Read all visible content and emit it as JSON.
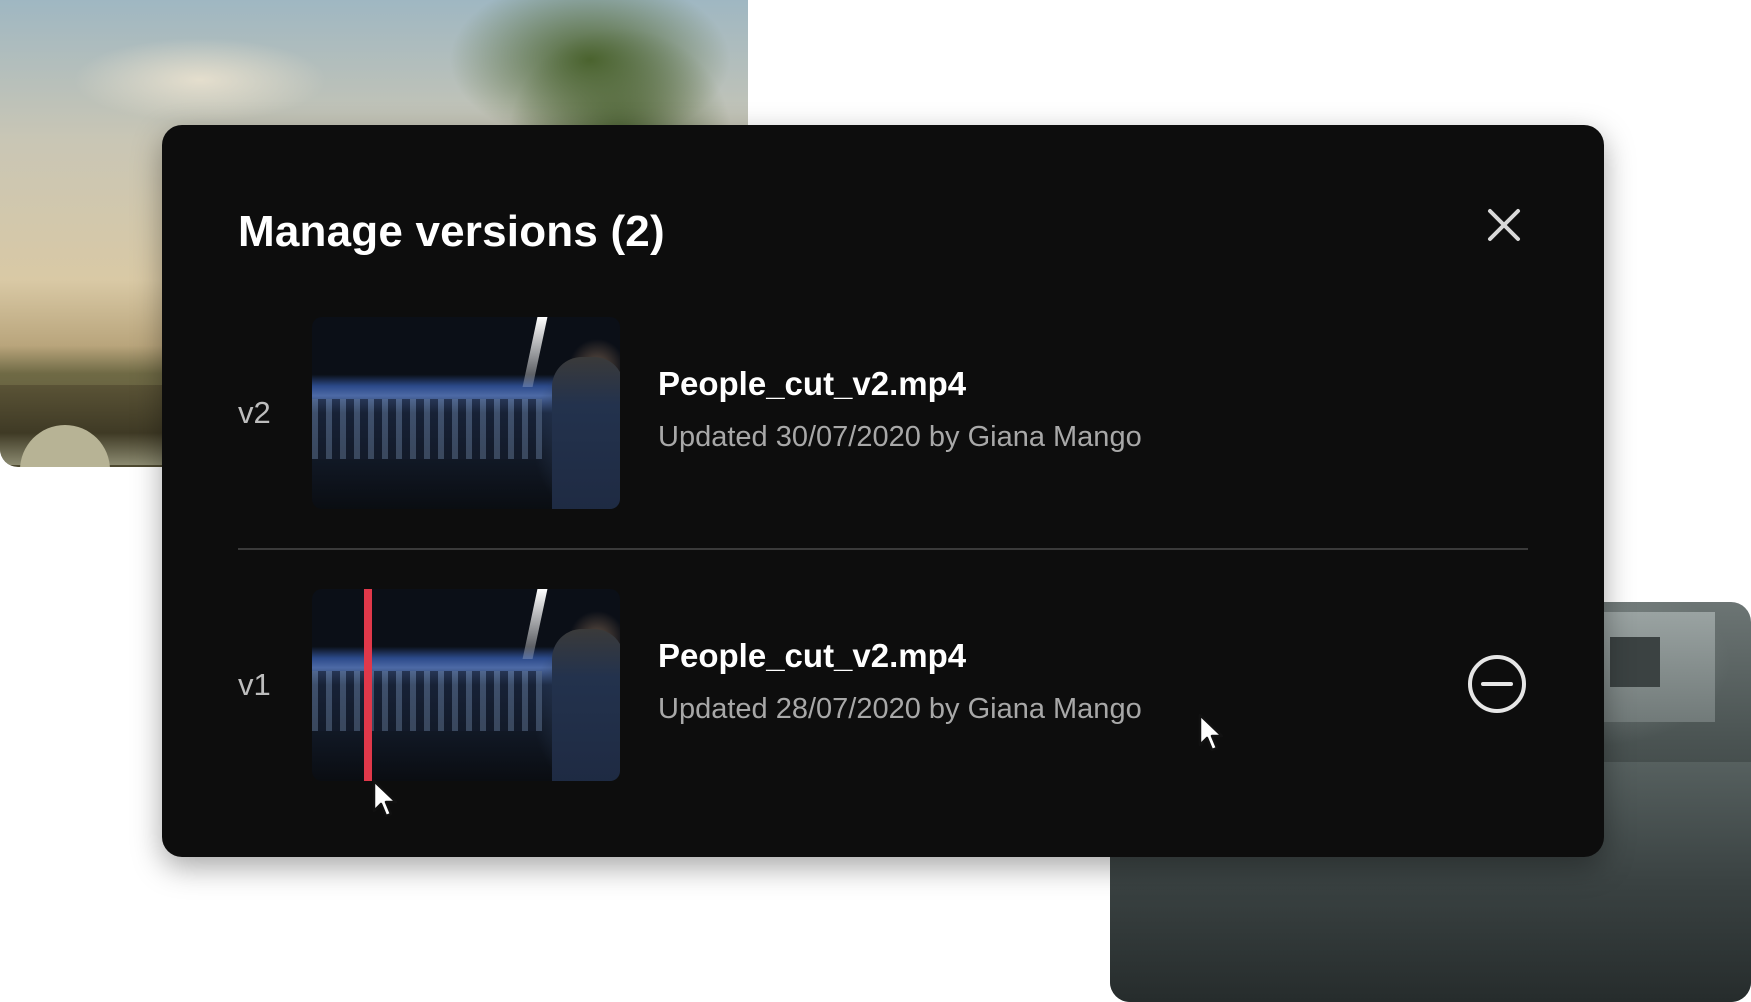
{
  "modal": {
    "title": "Manage versions (2)",
    "close_icon": "close-icon"
  },
  "versions": [
    {
      "label": "v2",
      "file_name": "People_cut_v2.mp4",
      "meta": "Updated 30/07/2020 by Giana Mango"
    },
    {
      "label": "v1",
      "file_name": "People_cut_v2.mp4",
      "meta": "Updated 28/07/2020 by Giana Mango",
      "action_icon": "remove-circle-icon"
    }
  ],
  "colors": {
    "modal_background": "#0d0d0d",
    "playhead": "#e0384a",
    "title_text": "#ffffff",
    "meta_text": "#a8a8a8"
  }
}
